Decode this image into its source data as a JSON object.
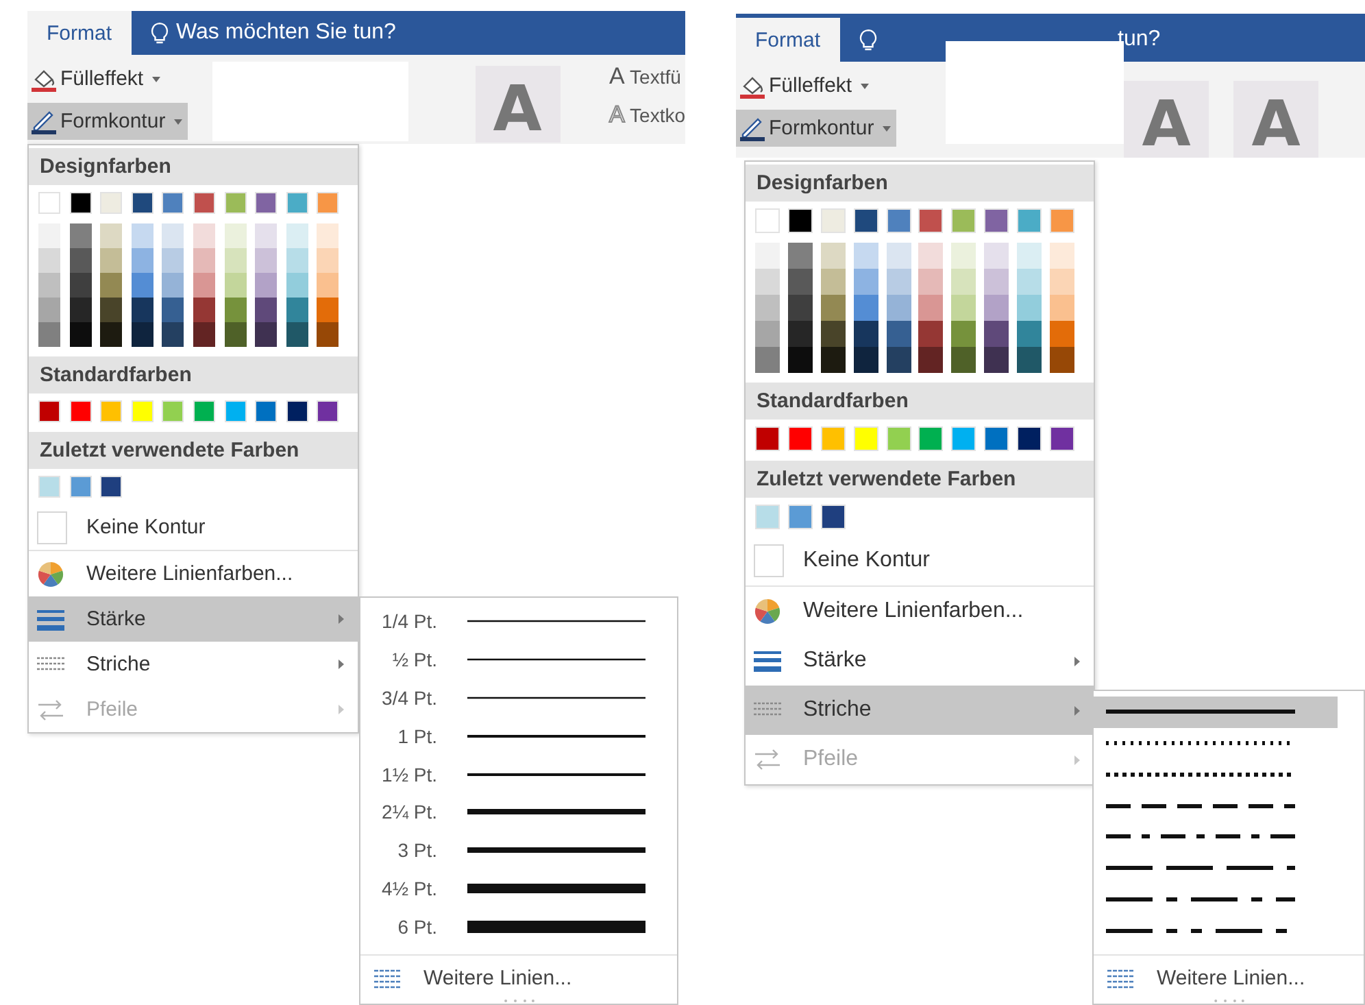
{
  "panels": [
    {
      "tabs": [
        {
          "label": "Format",
          "selected": true
        }
      ],
      "tell_me": {
        "text": "Was möchten Sie tun?"
      },
      "ribbon_buttons": [
        {
          "kind": "fill",
          "label": "Fülleffekt",
          "selected": false
        },
        {
          "kind": "outline",
          "label": "Formkontur",
          "selected": true
        }
      ],
      "gallery": [
        {
          "label": "A"
        }
      ],
      "text_buttons": [
        {
          "kind": "fill",
          "glyph": "A",
          "label": "Textfü"
        },
        {
          "kind": "outline",
          "glyph": "A",
          "label": "Textko"
        }
      ],
      "menu": {
        "theme_colors": {
          "title": "Designfarben",
          "top": [
            {
              "color": "#ffffff"
            },
            {
              "color": "#000000"
            },
            {
              "color": "#eeece1"
            },
            {
              "color": "#1f497d"
            },
            {
              "color": "#4f81bd"
            },
            {
              "color": "#c0504d"
            },
            {
              "color": "#9bbb59"
            },
            {
              "color": "#8064a2"
            },
            {
              "color": "#4bacc6"
            },
            {
              "color": "#f79646"
            }
          ],
          "shades": [
            [
              {
                "color": "#f2f2f2"
              },
              {
                "color": "#d9d9d9"
              },
              {
                "color": "#bfbfbf"
              },
              {
                "color": "#a6a6a6"
              },
              {
                "color": "#808080"
              }
            ],
            [
              {
                "color": "#7f7f7f"
              },
              {
                "color": "#595959"
              },
              {
                "color": "#3f3f3f"
              },
              {
                "color": "#262626"
              },
              {
                "color": "#0d0d0d"
              }
            ],
            [
              {
                "color": "#ddd9c3"
              },
              {
                "color": "#c4bd97"
              },
              {
                "color": "#938953"
              },
              {
                "color": "#494429"
              },
              {
                "color": "#1d1b10"
              }
            ],
            [
              {
                "color": "#c6d9f0"
              },
              {
                "color": "#8db3e2"
              },
              {
                "color": "#548dd4"
              },
              {
                "color": "#17365d"
              },
              {
                "color": "#0f243e"
              }
            ],
            [
              {
                "color": "#dbe5f1"
              },
              {
                "color": "#b8cce4"
              },
              {
                "color": "#95b3d7"
              },
              {
                "color": "#366092"
              },
              {
                "color": "#244061"
              }
            ],
            [
              {
                "color": "#f2dcdb"
              },
              {
                "color": "#e5b9b7"
              },
              {
                "color": "#d99694"
              },
              {
                "color": "#953734"
              },
              {
                "color": "#632423"
              }
            ],
            [
              {
                "color": "#ebf1dd"
              },
              {
                "color": "#d7e3bc"
              },
              {
                "color": "#c3d69b"
              },
              {
                "color": "#76923c"
              },
              {
                "color": "#4f6128"
              }
            ],
            [
              {
                "color": "#e5e0ec"
              },
              {
                "color": "#ccc1d9"
              },
              {
                "color": "#b2a2c7"
              },
              {
                "color": "#5f497a"
              },
              {
                "color": "#3f3151"
              }
            ],
            [
              {
                "color": "#dbeef3"
              },
              {
                "color": "#b7dde8"
              },
              {
                "color": "#92cddc"
              },
              {
                "color": "#31859b"
              },
              {
                "color": "#205867"
              }
            ],
            [
              {
                "color": "#fdeada"
              },
              {
                "color": "#fbd5b5"
              },
              {
                "color": "#fac08f"
              },
              {
                "color": "#e36c09"
              },
              {
                "color": "#974806"
              }
            ]
          ]
        },
        "standard_colors": {
          "title": "Standardfarben",
          "swatches": [
            {
              "color": "#c00000"
            },
            {
              "color": "#ff0000"
            },
            {
              "color": "#ffc000"
            },
            {
              "color": "#ffff00"
            },
            {
              "color": "#92d050"
            },
            {
              "color": "#00b050"
            },
            {
              "color": "#00b0f0"
            },
            {
              "color": "#0070c0"
            },
            {
              "color": "#002060"
            },
            {
              "color": "#7030a0"
            }
          ]
        },
        "recent_colors": {
          "title": "Zuletzt verwendete Farben",
          "swatches": [
            {
              "color": "#b7dde8"
            },
            {
              "color": "#5b9bd5"
            },
            {
              "color": "#1f3f7f"
            }
          ]
        },
        "items": [
          {
            "kind": "no-outline",
            "label": "Keine Kontur",
            "selected": false,
            "disabled": false,
            "has_submenu": false
          },
          {
            "kind": "more-colors",
            "label": "Weitere Linienfarben...",
            "selected": false,
            "disabled": false,
            "has_submenu": false
          },
          {
            "kind": "weight",
            "label": "Stärke",
            "selected": true,
            "disabled": false,
            "has_submenu": true
          },
          {
            "kind": "dashes",
            "label": "Striche",
            "selected": false,
            "disabled": false,
            "has_submenu": true
          },
          {
            "kind": "arrows",
            "label": "Pfeile",
            "selected": false,
            "disabled": true,
            "has_submenu": true
          }
        ]
      },
      "submenu": {
        "kind": "weights",
        "items": [
          {
            "label": "1/4 Pt.",
            "kind": "hair"
          },
          {
            "label": "½ Pt.",
            "kind": "hair"
          },
          {
            "label": "3/4 Pt.",
            "kind": "hair"
          },
          {
            "label": "1 Pt.",
            "kind": "thin"
          },
          {
            "label": "1½ Pt.",
            "kind": "thin"
          },
          {
            "label": "2¼ Pt.",
            "kind": "medium"
          },
          {
            "label": "3 Pt.",
            "kind": "medium"
          },
          {
            "label": "4½ Pt.",
            "kind": "heavy"
          },
          {
            "label": "6 Pt.",
            "kind": "heaviest"
          }
        ],
        "footer": "Weitere Linien..."
      }
    },
    {
      "tabs": [
        {
          "label": "Format",
          "selected": true
        }
      ],
      "tell_me": {
        "text": "tun?"
      },
      "ribbon_buttons": [
        {
          "kind": "fill",
          "label": "Fülleffekt",
          "selected": false
        },
        {
          "kind": "outline",
          "label": "Formkontur",
          "selected": true
        }
      ],
      "gallery": [
        {
          "label": "A"
        },
        {
          "label": "A"
        }
      ],
      "menu": {
        "theme_colors": {
          "title": "Designfarben",
          "top": [
            {
              "color": "#ffffff"
            },
            {
              "color": "#000000"
            },
            {
              "color": "#eeece1"
            },
            {
              "color": "#1f497d"
            },
            {
              "color": "#4f81bd"
            },
            {
              "color": "#c0504d"
            },
            {
              "color": "#9bbb59"
            },
            {
              "color": "#8064a2"
            },
            {
              "color": "#4bacc6"
            },
            {
              "color": "#f79646"
            }
          ],
          "shades": [
            [
              {
                "color": "#f2f2f2"
              },
              {
                "color": "#d9d9d9"
              },
              {
                "color": "#bfbfbf"
              },
              {
                "color": "#a6a6a6"
              },
              {
                "color": "#808080"
              }
            ],
            [
              {
                "color": "#7f7f7f"
              },
              {
                "color": "#595959"
              },
              {
                "color": "#3f3f3f"
              },
              {
                "color": "#262626"
              },
              {
                "color": "#0d0d0d"
              }
            ],
            [
              {
                "color": "#ddd9c3"
              },
              {
                "color": "#c4bd97"
              },
              {
                "color": "#938953"
              },
              {
                "color": "#494429"
              },
              {
                "color": "#1d1b10"
              }
            ],
            [
              {
                "color": "#c6d9f0"
              },
              {
                "color": "#8db3e2"
              },
              {
                "color": "#548dd4"
              },
              {
                "color": "#17365d"
              },
              {
                "color": "#0f243e"
              }
            ],
            [
              {
                "color": "#dbe5f1"
              },
              {
                "color": "#b8cce4"
              },
              {
                "color": "#95b3d7"
              },
              {
                "color": "#366092"
              },
              {
                "color": "#244061"
              }
            ],
            [
              {
                "color": "#f2dcdb"
              },
              {
                "color": "#e5b9b7"
              },
              {
                "color": "#d99694"
              },
              {
                "color": "#953734"
              },
              {
                "color": "#632423"
              }
            ],
            [
              {
                "color": "#ebf1dd"
              },
              {
                "color": "#d7e3bc"
              },
              {
                "color": "#c3d69b"
              },
              {
                "color": "#76923c"
              },
              {
                "color": "#4f6128"
              }
            ],
            [
              {
                "color": "#e5e0ec"
              },
              {
                "color": "#ccc1d9"
              },
              {
                "color": "#b2a2c7"
              },
              {
                "color": "#5f497a"
              },
              {
                "color": "#3f3151"
              }
            ],
            [
              {
                "color": "#dbeef3"
              },
              {
                "color": "#b7dde8"
              },
              {
                "color": "#92cddc"
              },
              {
                "color": "#31859b"
              },
              {
                "color": "#205867"
              }
            ],
            [
              {
                "color": "#fdeada"
              },
              {
                "color": "#fbd5b5"
              },
              {
                "color": "#fac08f"
              },
              {
                "color": "#e36c09"
              },
              {
                "color": "#974806"
              }
            ]
          ]
        },
        "standard_colors": {
          "title": "Standardfarben",
          "swatches": [
            {
              "color": "#c00000"
            },
            {
              "color": "#ff0000"
            },
            {
              "color": "#ffc000"
            },
            {
              "color": "#ffff00"
            },
            {
              "color": "#92d050"
            },
            {
              "color": "#00b050"
            },
            {
              "color": "#00b0f0"
            },
            {
              "color": "#0070c0"
            },
            {
              "color": "#002060"
            },
            {
              "color": "#7030a0"
            }
          ]
        },
        "recent_colors": {
          "title": "Zuletzt verwendete Farben",
          "swatches": [
            {
              "color": "#b7dde8"
            },
            {
              "color": "#5b9bd5"
            },
            {
              "color": "#1f3f7f"
            }
          ]
        },
        "items": [
          {
            "kind": "no-outline",
            "label": "Keine Kontur",
            "selected": false,
            "disabled": false,
            "has_submenu": false
          },
          {
            "kind": "more-colors",
            "label": "Weitere Linienfarben...",
            "selected": false,
            "disabled": false,
            "has_submenu": false
          },
          {
            "kind": "weight",
            "label": "Stärke",
            "selected": false,
            "disabled": false,
            "has_submenu": true
          },
          {
            "kind": "dashes",
            "label": "Striche",
            "selected": true,
            "disabled": false,
            "has_submenu": true
          },
          {
            "kind": "arrows",
            "label": "Pfeile",
            "selected": false,
            "disabled": true,
            "has_submenu": true
          }
        ]
      },
      "submenu": {
        "kind": "dashes",
        "items": [
          {
            "kind": "solid",
            "selected": true
          },
          {
            "kind": "round-dot",
            "selected": false
          },
          {
            "kind": "square-dot",
            "selected": false
          },
          {
            "kind": "dash",
            "selected": false
          },
          {
            "kind": "dash-dot",
            "selected": false
          },
          {
            "kind": "long-dash",
            "selected": false
          },
          {
            "kind": "long-dash-dot",
            "selected": false
          },
          {
            "kind": "long-dash-dot-dot",
            "selected": false
          }
        ],
        "footer": "Weitere Linien..."
      }
    }
  ]
}
